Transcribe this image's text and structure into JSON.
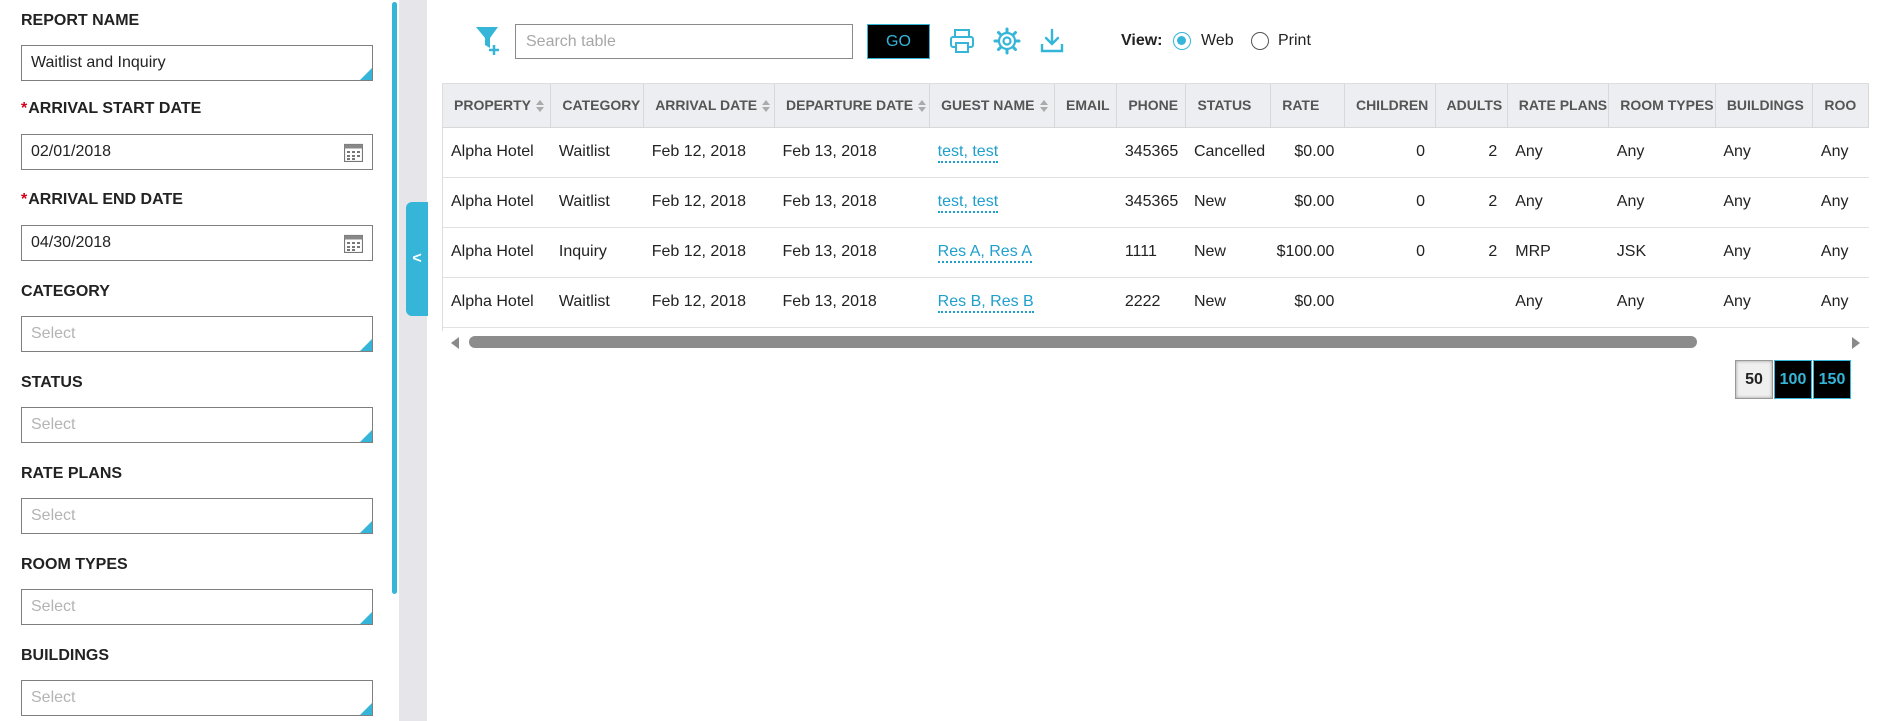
{
  "filters": {
    "report_name": {
      "label": "REPORT NAME",
      "value": "Waitlist and Inquiry"
    },
    "arrival_start": {
      "required_mark": "*",
      "label": "ARRIVAL START DATE",
      "value": "02/01/2018"
    },
    "arrival_end": {
      "required_mark": "*",
      "label": "ARRIVAL END DATE",
      "value": "04/30/2018"
    },
    "category": {
      "label": "CATEGORY",
      "placeholder": "Select"
    },
    "status": {
      "label": "STATUS",
      "placeholder": "Select"
    },
    "rate_plans": {
      "label": "RATE PLANS",
      "placeholder": "Select"
    },
    "room_types": {
      "label": "ROOM TYPES",
      "placeholder": "Select"
    },
    "buildings": {
      "label": "BUILDINGS",
      "placeholder": "Select"
    }
  },
  "collapse_toggle": "<",
  "toolbar": {
    "search_placeholder": "Search table",
    "go_label": "GO",
    "view_label": "View:",
    "view_options": [
      {
        "label": "Web",
        "selected": true
      },
      {
        "label": "Print",
        "selected": false
      }
    ]
  },
  "table": {
    "columns": [
      "PROPERTY",
      "CATEGORY",
      "ARRIVAL DATE",
      "DEPARTURE DATE",
      "GUEST NAME",
      "EMAIL",
      "PHONE",
      "STATUS",
      "RATE",
      "CHILDREN",
      "ADULTS",
      "RATE PLANS",
      "ROOM TYPES",
      "BUILDINGS",
      "ROO"
    ],
    "rows": [
      [
        "Alpha Hotel",
        "Waitlist",
        "Feb 12, 2018",
        "Feb 13, 2018",
        "test, test",
        "",
        "345365",
        "Cancelled",
        "$0.00",
        "0",
        "2",
        "Any",
        "Any",
        "Any",
        "Any"
      ],
      [
        "Alpha Hotel",
        "Waitlist",
        "Feb 12, 2018",
        "Feb 13, 2018",
        "test, test",
        "",
        "345365",
        "New",
        "$0.00",
        "0",
        "2",
        "Any",
        "Any",
        "Any",
        "Any"
      ],
      [
        "Alpha Hotel",
        "Inquiry",
        "Feb 12, 2018",
        "Feb 13, 2018",
        "Res A, Res A",
        "",
        "1111",
        "New",
        "$100.00",
        "0",
        "2",
        "MRP",
        "JSK",
        "Any",
        "Any"
      ],
      [
        "Alpha Hotel",
        "Waitlist",
        "Feb 12, 2018",
        "Feb 13, 2018",
        "Res B, Res B",
        "",
        "2222",
        "New",
        "$0.00",
        "",
        "",
        "Any",
        "Any",
        "Any",
        "Any"
      ]
    ]
  },
  "pagination": {
    "sizes": [
      "50",
      "100",
      "150"
    ],
    "selected": "50"
  },
  "colors": {
    "accent": "#35b6d9",
    "required": "#d0021b",
    "header_bg": "#eceef1"
  }
}
